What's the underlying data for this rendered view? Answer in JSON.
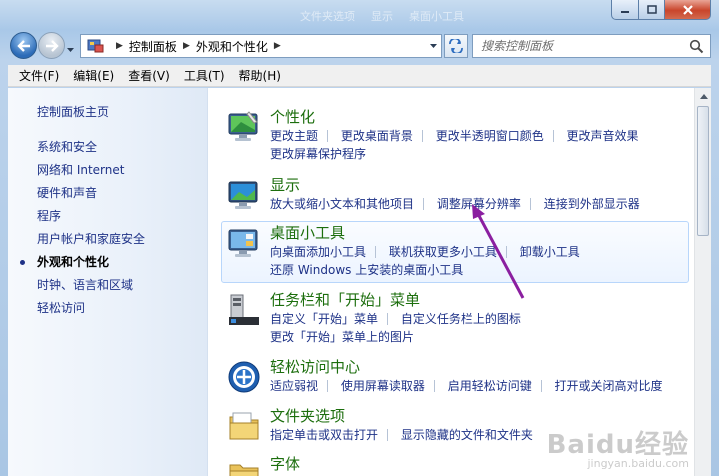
{
  "window": {
    "caption_ghost": [
      "文件夹选项",
      "显示",
      "桌面小工具"
    ]
  },
  "address_bar": {
    "crumbs": [
      "控制面板",
      "外观和个性化"
    ],
    "search_placeholder": "搜索控制面板"
  },
  "menu": [
    "文件(F)",
    "编辑(E)",
    "查看(V)",
    "工具(T)",
    "帮助(H)"
  ],
  "sidebar": {
    "home": "控制面板主页",
    "items": [
      {
        "label": "系统和安全"
      },
      {
        "label": "网络和 Internet"
      },
      {
        "label": "硬件和声音"
      },
      {
        "label": "程序"
      },
      {
        "label": "用户帐户和家庭安全"
      },
      {
        "label": "外观和个性化",
        "current": true
      },
      {
        "label": "时钟、语言和区域"
      },
      {
        "label": "轻松访问"
      }
    ]
  },
  "categories": [
    {
      "title": "个性化",
      "icon": "personalization-icon",
      "rows": [
        [
          "更改主题",
          "更改桌面背景",
          "更改半透明窗口颜色",
          "更改声音效果"
        ],
        [
          "更改屏幕保护程序"
        ]
      ]
    },
    {
      "title": "显示",
      "icon": "display-icon",
      "rows": [
        [
          "放大或缩小文本和其他项目",
          "调整屏幕分辨率",
          "连接到外部显示器"
        ]
      ]
    },
    {
      "title": "桌面小工具",
      "icon": "gadgets-icon",
      "highlighted": true,
      "rows": [
        [
          "向桌面添加小工具",
          "联机获取更多小工具",
          "卸载小工具"
        ],
        [
          "还原 Windows 上安装的桌面小工具"
        ]
      ]
    },
    {
      "title": "任务栏和「开始」菜单",
      "icon": "taskbar-icon",
      "rows": [
        [
          "自定义「开始」菜单",
          "自定义任务栏上的图标"
        ],
        [
          "更改「开始」菜单上的图片"
        ]
      ]
    },
    {
      "title": "轻松访问中心",
      "icon": "ease-of-access-icon",
      "rows": [
        [
          "适应弱视",
          "使用屏幕读取器",
          "启用轻松访问键",
          "打开或关闭高对比度"
        ]
      ]
    },
    {
      "title": "文件夹选项",
      "icon": "folder-options-icon",
      "rows": [
        [
          "指定单击或双击打开",
          "显示隐藏的文件和文件夹"
        ]
      ]
    },
    {
      "title": "字体",
      "icon": "fonts-icon",
      "rows": []
    }
  ],
  "watermark": {
    "brand": "Baidu经验",
    "url": "jingyan.baidu.com"
  },
  "colors": {
    "link": "#1e3287",
    "category_title": "#1c6e0d",
    "annotation_arrow": "#8b1fa0"
  }
}
